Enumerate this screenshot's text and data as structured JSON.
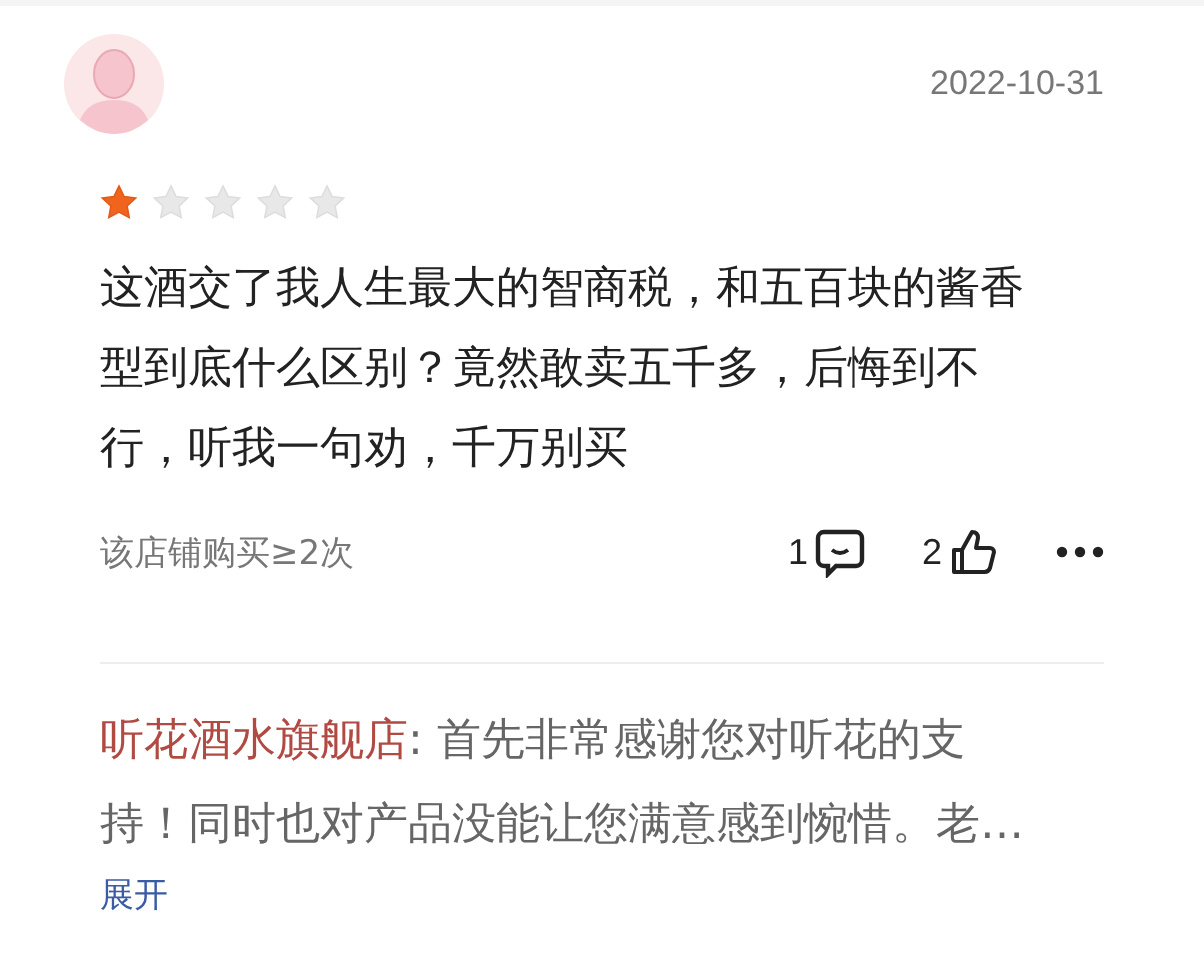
{
  "date": "2022-10-31",
  "stars": 1,
  "review": "这酒交了我人生最大的智商税，和五百块的酱香型到底什么区别？竟然敢卖五千多，后悔到不行，听我一句劝，千万别买",
  "purchase_note": "该店铺购买≥2次",
  "comment_count": "1",
  "like_count": "2",
  "reply": {
    "store": "听花酒水旗舰店",
    "lines": [
      ": 首先非常感谢您对听花的支",
      "持！同时也对产品没能让您满意感到惋惜。老…"
    ]
  },
  "expand": "展开"
}
